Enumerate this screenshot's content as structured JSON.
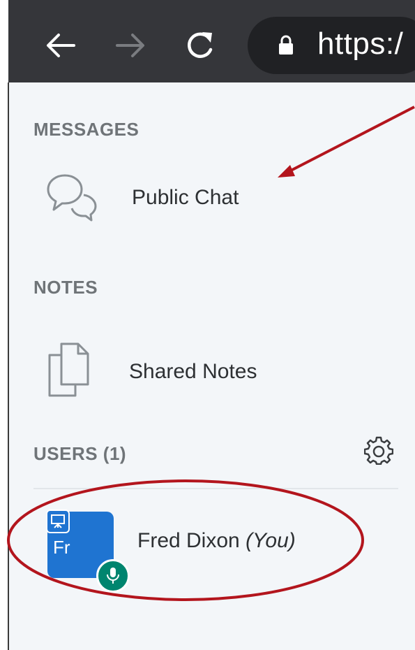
{
  "browser": {
    "url_text": "https:/",
    "icons": [
      "back-arrow-icon",
      "forward-arrow-icon",
      "reload-icon",
      "lock-icon"
    ]
  },
  "messages": {
    "title": "MESSAGES",
    "public_chat": {
      "label": "Public Chat",
      "icon": "chat-bubbles-icon"
    }
  },
  "notes": {
    "title": "NOTES",
    "shared_notes": {
      "label": "Shared Notes",
      "icon": "documents-icon"
    }
  },
  "users": {
    "title": "USERS (1)",
    "settings_icon": "gear-icon",
    "list": [
      {
        "initials": "Fr",
        "name": "Fred Dixon",
        "tag": "(You)"
      }
    ]
  },
  "colors": {
    "toolbar": "#35363a",
    "panel_bg": "#f3f6f9",
    "avatar": "#1f74d1",
    "mic_badge": "#00856f",
    "annotation": "#b3151d"
  }
}
